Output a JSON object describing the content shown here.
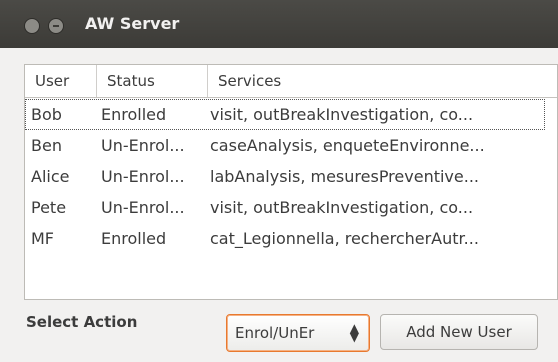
{
  "window": {
    "title": "AW Server"
  },
  "table": {
    "headers": {
      "user": "User",
      "status": "Status",
      "services": "Services"
    },
    "rows": [
      {
        "user": "Bob",
        "status": "Enrolled",
        "services": "visit, outBreakInvestigation, co..."
      },
      {
        "user": "Ben",
        "status": "Un-Enrol...",
        "services": "caseAnalysis, enqueteEnvironne..."
      },
      {
        "user": "Alice",
        "status": "Un-Enrol...",
        "services": "labAnalysis, mesuresPreventive..."
      },
      {
        "user": "Pete",
        "status": "Un-Enrol...",
        "services": "visit, outBreakInvestigation, co..."
      },
      {
        "user": "MF",
        "status": "Enrolled",
        "services": "cat_Legionnella, rechercherAutr..."
      }
    ]
  },
  "actions": {
    "select_label": "Select Action",
    "combo_value": "Enrol/UnEr",
    "add_button": "Add New User"
  },
  "colors": {
    "titlebar": "#3c3b37",
    "window_bg": "#f2f1f0",
    "focus_accent": "#e8792f"
  }
}
